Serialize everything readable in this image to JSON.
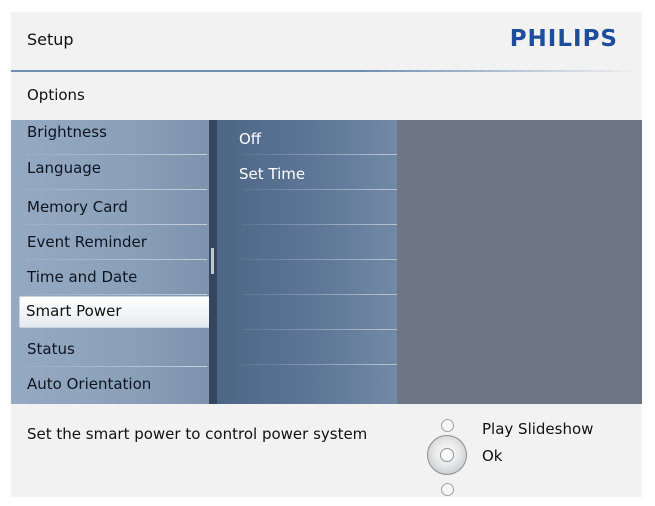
{
  "header": {
    "title": "Setup",
    "brand": "PHILIPS"
  },
  "subheader": {
    "label": "Options"
  },
  "menu": {
    "items": [
      {
        "label": "Brightness"
      },
      {
        "label": "Language"
      },
      {
        "label": "Memory Card"
      },
      {
        "label": "Event Reminder"
      },
      {
        "label": "Time and Date"
      },
      {
        "label": "Smart Power",
        "selected": true
      },
      {
        "label": "Status"
      },
      {
        "label": "Auto Orientation"
      }
    ]
  },
  "submenu": {
    "items": [
      {
        "label": "Off"
      },
      {
        "label": "Set Time"
      }
    ]
  },
  "footer": {
    "hint": "Set the smart power to control power system",
    "controls": {
      "up_label": "Play Slideshow",
      "ok_label": "Ok"
    }
  },
  "colors": {
    "brand": "#1d4e9c",
    "menu_bg": "#8aa0b9",
    "submenu_bg": "#5c7596",
    "content_bg": "#6d7685",
    "selected_bg": "#ffffff"
  }
}
